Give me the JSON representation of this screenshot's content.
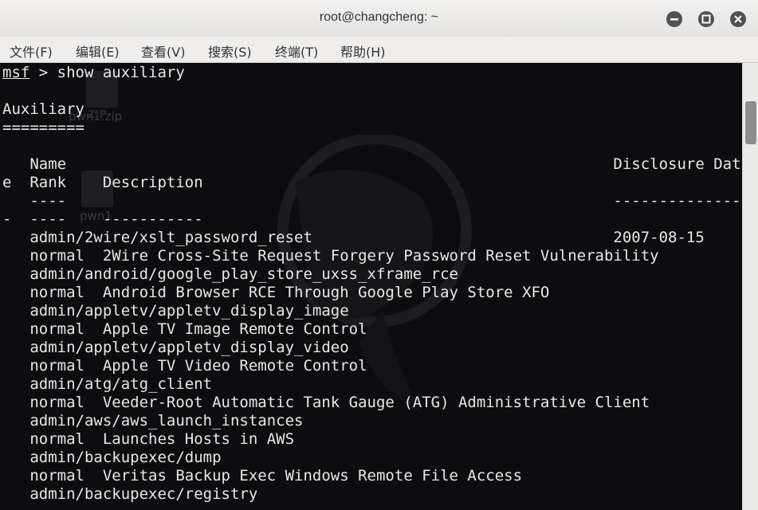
{
  "window": {
    "title": "root@changcheng: ~"
  },
  "menu": [
    "文件(F)",
    "编辑(E)",
    "查看(V)",
    "搜索(S)",
    "终端(T)",
    "帮助(H)"
  ],
  "desktop_icons": [
    {
      "label": "pwn1.zip",
      "badge": "ZIP"
    },
    {
      "label": "pwn1"
    }
  ],
  "terminal": {
    "prompt": "msf",
    "command": " > show auxiliary",
    "lines": [
      "",
      "Auxiliary",
      "=========",
      "",
      "   Name                                                            Disclosure Dat",
      "e  Rank    Description",
      "   ----                                                            --------------",
      "-  ----    -----------",
      "   admin/2wire/xslt_password_reset                                 2007-08-15",
      "   normal  2Wire Cross-Site Request Forgery Password Reset Vulnerability",
      "   admin/android/google_play_store_uxss_xframe_rce",
      "   normal  Android Browser RCE Through Google Play Store XFO",
      "   admin/appletv/appletv_display_image",
      "   normal  Apple TV Image Remote Control",
      "   admin/appletv/appletv_display_video",
      "   normal  Apple TV Video Remote Control",
      "   admin/atg/atg_client",
      "   normal  Veeder-Root Automatic Tank Gauge (ATG) Administrative Client",
      "   admin/aws/aws_launch_instances",
      "   normal  Launches Hosts in AWS",
      "   admin/backupexec/dump",
      "   normal  Veritas Backup Exec Windows Remote File Access",
      "   admin/backupexec/registry"
    ]
  },
  "scrollbar": {
    "position_fraction": 0.09
  }
}
